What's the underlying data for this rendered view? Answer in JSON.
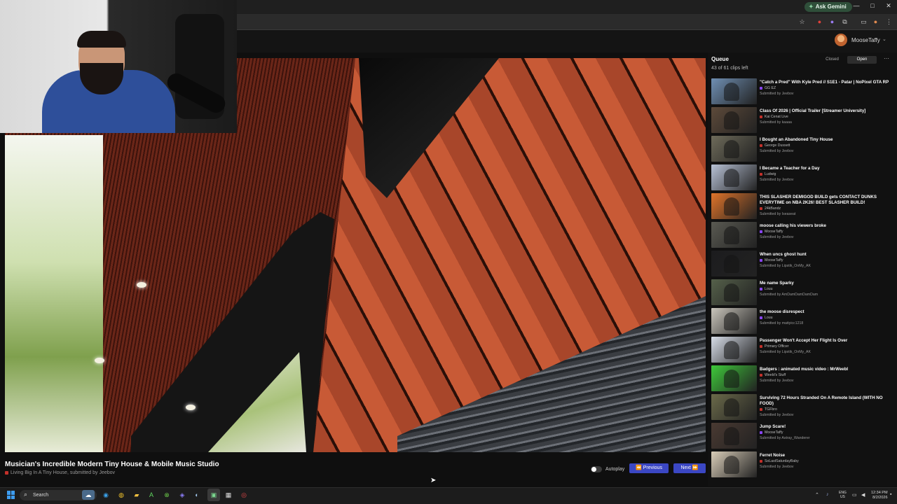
{
  "browser": {
    "gemini_label": "Ask Gemini",
    "win_minimize": "—",
    "win_restore": "□",
    "win_close": "✕"
  },
  "header": {
    "username": "MooseTaffy"
  },
  "player": {
    "title": "Musician's Incredible Modern Tiny House & Mobile Music Studio",
    "channel": "Living Big In A Tiny House",
    "submitted_prefix": ", submitted by ",
    "submitted_by": "Jeebov",
    "autoplay_label": "Autoplay",
    "prev_label": "Previous",
    "next_label": "Next"
  },
  "queue": {
    "title": "Queue",
    "count": "43 of 61 clips left",
    "tab_closed": "Closed",
    "tab_open": "Open",
    "more": "⋯",
    "items": [
      {
        "title": "\"Catch a Pred\" With Kyle Pred // S1E1 - Patar | NoPixel GTA RP",
        "channel": "GG EZ",
        "by": "Submitted by Jeebov",
        "platform": "twitch",
        "color": "#6f8fb3"
      },
      {
        "title": "Class Of 2026 | Official Trailer [Streamer University]",
        "channel": "Kai Cenat Live",
        "by": "Submitted by kaaaa",
        "platform": "youtube",
        "color": "#5d4a3a"
      },
      {
        "title": "I Bought an Abandoned Tiny House",
        "channel": "George Dussett",
        "by": "Submitted by Jeebov",
        "platform": "youtube",
        "color": "#6e6b5a"
      },
      {
        "title": "I Became a Teacher for a Day",
        "channel": "Ludwig",
        "by": "Submitted by Jeebov",
        "platform": "youtube",
        "color": "#b8c2d6"
      },
      {
        "title": "THIS SLASHER DEMIGOD BUILD gets CONTACT DUNKS EVERYTIME on NBA 2K26! BEST SLASHER BUILD!",
        "channel": "24kBandz",
        "by": "Submitted by Iseaseat",
        "platform": "youtube",
        "color": "#e0742a",
        "tall": true
      },
      {
        "title": "moose calling his viewers broke",
        "channel": "MooseTaffy",
        "by": "Submitted by Jeebov",
        "platform": "twitch",
        "color": "#5a5a52"
      },
      {
        "title": "When uncs ghost hunt",
        "channel": "MooseTaffy",
        "by": "Submitted by Lipstik_OnMy_AK",
        "platform": "twitch",
        "color": "#1c1c1e"
      },
      {
        "title": "Me name Sparky",
        "channel": "Louu",
        "by": "Submitted by AmDamDamDamDam",
        "platform": "twitch",
        "color": "#55604a"
      },
      {
        "title": "the moose disrespect",
        "channel": "Louu",
        "by": "Submitted by mattyicc1218",
        "platform": "twitch",
        "color": "#c9c5bb"
      },
      {
        "title": "Passenger Won't Accept Her Flight Is Over",
        "channel": "Primary Officer",
        "by": "Submitted by Lipstik_OnMy_AK",
        "platform": "youtube",
        "color": "#d7dde8"
      },
      {
        "title": "Badgers : animated music video : MrWeebl",
        "channel": "Weebl's Stuff",
        "by": "Submitted by Jeebov",
        "platform": "youtube",
        "color": "#3ec93a"
      },
      {
        "title": "Surviving 72 Hours Stranded On A Remote Island (WITH NO FOOD)",
        "channel": "TGFbro",
        "by": "Submitted by Jeebov",
        "platform": "youtube",
        "color": "#6b6a4a",
        "tall": true
      },
      {
        "title": "Jump Scare!",
        "channel": "MooseTaffy",
        "by": "Submitted by Astray_Wanderer",
        "platform": "twitch",
        "color": "#4a3a32"
      },
      {
        "title": "Ferret Noise",
        "channel": "SoLastSaturdayBaby",
        "by": "Submitted by Jeebov",
        "platform": "youtube",
        "color": "#d9cdb8"
      }
    ]
  },
  "taskbar": {
    "search_label": "Search",
    "lang_top": "ENG",
    "lang_bottom": "US",
    "time": "12:34 PM",
    "date": "8/2/2026"
  }
}
